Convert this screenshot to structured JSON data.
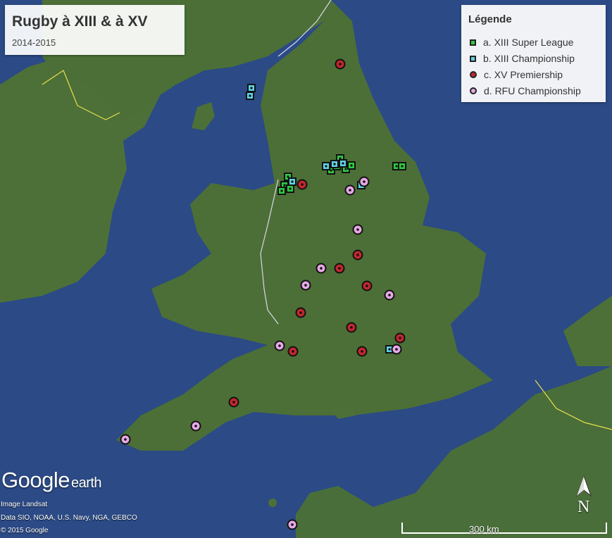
{
  "title": "Rugby à XIII & à XV",
  "subtitle": "2014-2015",
  "legend": {
    "title": "Légende",
    "items": [
      {
        "label": "a. XIII Super League",
        "marker": "square",
        "color": "#2ecc40"
      },
      {
        "label": "b. XIII Championship",
        "marker": "square",
        "color": "#5fd3e6"
      },
      {
        "label": "c. XV Premiership",
        "marker": "circle",
        "color": "#c1272d"
      },
      {
        "label": "d. RFU Championship",
        "marker": "circle",
        "color": "#e6a8e6"
      }
    ]
  },
  "branding": {
    "logo_main": "Google",
    "logo_sub": "earth"
  },
  "credits": [
    "Image Landsat",
    "Data SIO, NOAA, U.S. Navy, NGA, GEBCO",
    "© 2015 Google"
  ],
  "scale_label": "300 km",
  "north_label": "N",
  "colors": {
    "sea": "#2b4a86",
    "land": "#4a6e38",
    "super_league": "#2ecc40",
    "championship": "#5fd3e6",
    "premiership": "#c1272d",
    "rfu": "#e6a8e6"
  }
}
